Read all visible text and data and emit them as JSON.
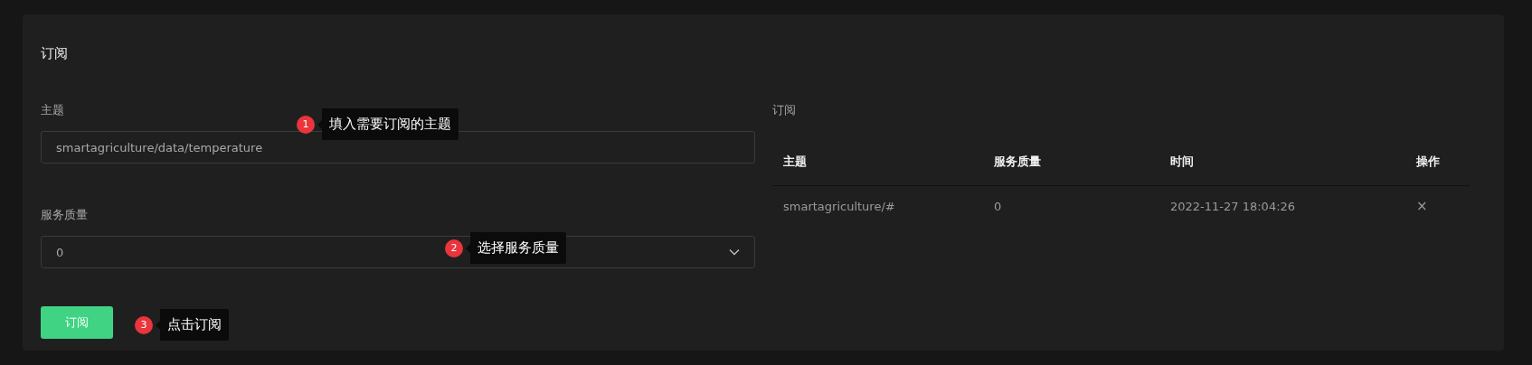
{
  "panel": {
    "title": "订阅"
  },
  "form": {
    "topic": {
      "label": "主题",
      "value": "smartagriculture/data/temperature"
    },
    "qos": {
      "label": "服务质量",
      "value": "0"
    },
    "submit": "订阅"
  },
  "subscriptions": {
    "title": "订阅",
    "columns": [
      "主题",
      "服务质量",
      "时间",
      "操作"
    ],
    "rows": [
      {
        "topic": "smartagriculture/#",
        "qos": "0",
        "time": "2022-11-27 18:04:26",
        "action": "×"
      }
    ]
  },
  "annotations": [
    {
      "number": "1",
      "text": "填入需要订阅的主题"
    },
    {
      "number": "2",
      "text": "选择服务质量"
    },
    {
      "number": "3",
      "text": "点击订阅"
    }
  ]
}
